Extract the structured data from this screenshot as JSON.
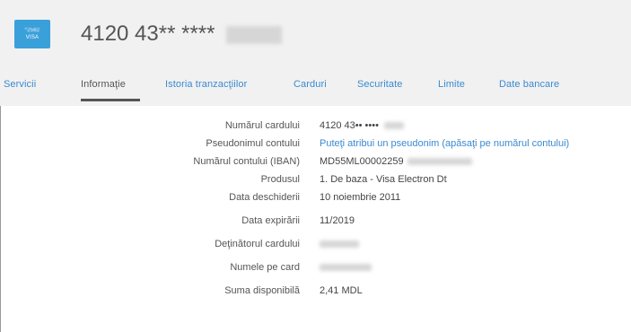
{
  "card": {
    "badge_top": "*2582",
    "badge_bottom": "VISA",
    "title_number": "4120 43** ****"
  },
  "tabs": [
    {
      "label": "Servicii"
    },
    {
      "label": "Informaţie"
    },
    {
      "label": "Istoria tranzacţiilor"
    },
    {
      "label": "Carduri"
    },
    {
      "label": "Securitate"
    },
    {
      "label": "Limite"
    },
    {
      "label": "Date bancare"
    }
  ],
  "details": [
    {
      "label": "Numărul cardului",
      "value": "4120 43•• ••••"
    },
    {
      "label": "Pseudonimul contului",
      "value": "Puteţi atribui un pseudonim (apăsaţi pe numărul contului)"
    },
    {
      "label": "Numărul contului (IBAN)",
      "value": "MD55ML00002259"
    },
    {
      "label": "Produsul",
      "value": "1. De baza - Visa Electron Dt"
    },
    {
      "label": "Data deschiderii",
      "value": "10 noiembrie 2011"
    },
    {
      "label": "Data expirării",
      "value": "11/2019"
    },
    {
      "label": "Deţinătorul cardului",
      "value": ""
    },
    {
      "label": "Numele pe card",
      "value": ""
    },
    {
      "label": "Suma disponibilă",
      "value": "2,41 MDL"
    }
  ],
  "colors": {
    "accent": "#3b8ad0",
    "badge": "#3aa0da",
    "header_bg": "#f1f1f1"
  }
}
